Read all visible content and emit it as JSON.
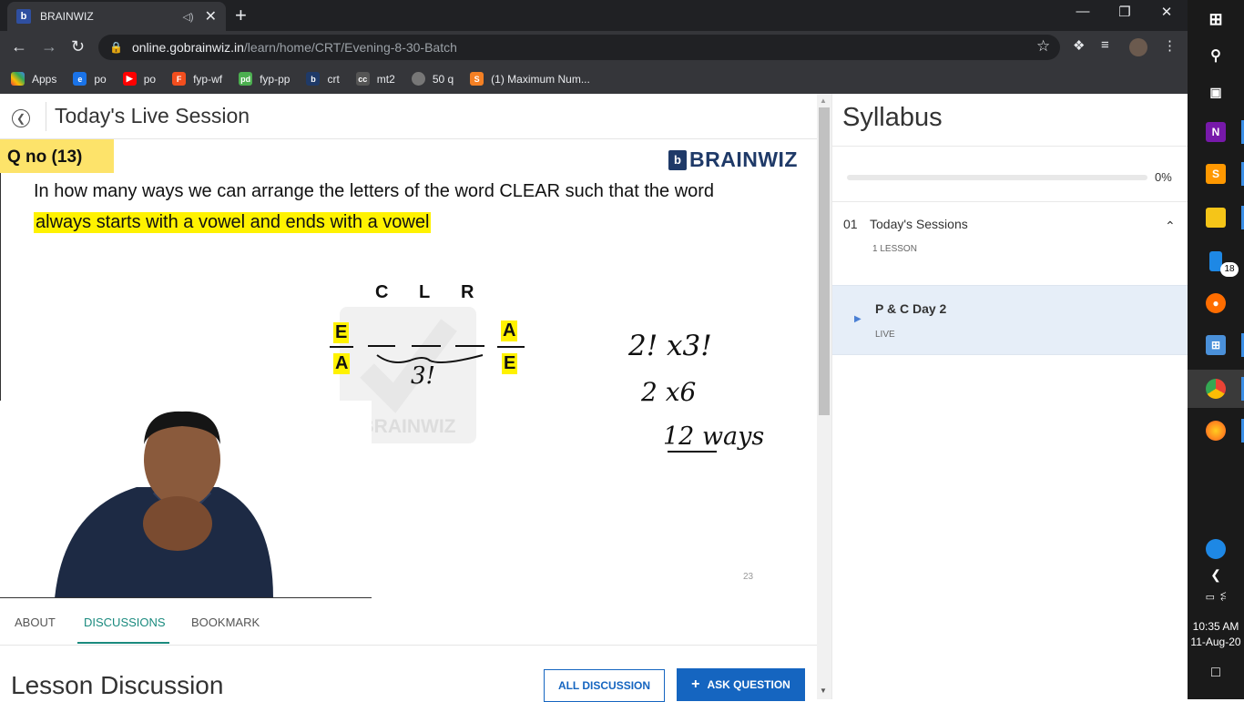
{
  "browser": {
    "tab_title": "BRAINWIZ",
    "url_host": "online.gobrainwiz.in",
    "url_path": "/learn/home/CRT/Evening-8-30-Batch",
    "bookmarks": [
      "Apps",
      "po",
      "po",
      "fyp-wf",
      "fyp-pp",
      "crt",
      "mt2",
      "50 q",
      "(1) Maximum Num..."
    ]
  },
  "page": {
    "title": "Today's Live Session"
  },
  "slide": {
    "qno": "Q no (13)",
    "logo_text": "BRAINWIZ",
    "question_line1": "In how many ways we can arrange the letters of the word CLEAR such that the word",
    "question_line2": "always starts with a vowel and ends with a vowel",
    "middle_letters": [
      "C",
      "L",
      "R"
    ],
    "first_letters": [
      "E",
      "A"
    ],
    "last_letters": [
      "A",
      "E"
    ],
    "hand_underbrace": "3!",
    "hand_line1": "2! x3!",
    "hand_line2": "2 x6",
    "hand_line3": "12 ways",
    "watermark": "BRAINWIZ",
    "page_number": "23"
  },
  "tabs": [
    "ABOUT",
    "DISCUSSIONS",
    "BOOKMARK"
  ],
  "active_tab": "DISCUSSIONS",
  "discussion": {
    "title": "Lesson Discussion",
    "all_button": "ALL DISCUSSION",
    "ask_button": "ASK QUESTION"
  },
  "syllabus": {
    "title": "Syllabus",
    "progress_percent": 0,
    "progress_label": "0%",
    "section_number": "01",
    "section_name": "Today's Sessions",
    "section_count": "1 LESSON",
    "lesson_name": "P & C Day 2",
    "lesson_status": "LIVE"
  },
  "taskbar": {
    "badge": "18",
    "time": "10:35 AM",
    "date": "11-Aug-20"
  },
  "colors": {
    "accent_teal": "#1a8a7e",
    "button_blue": "#1565c0",
    "highlight_yellow": "#fff200",
    "qno_yellow": "#fde36a",
    "brand_navy": "#1f3a68"
  }
}
